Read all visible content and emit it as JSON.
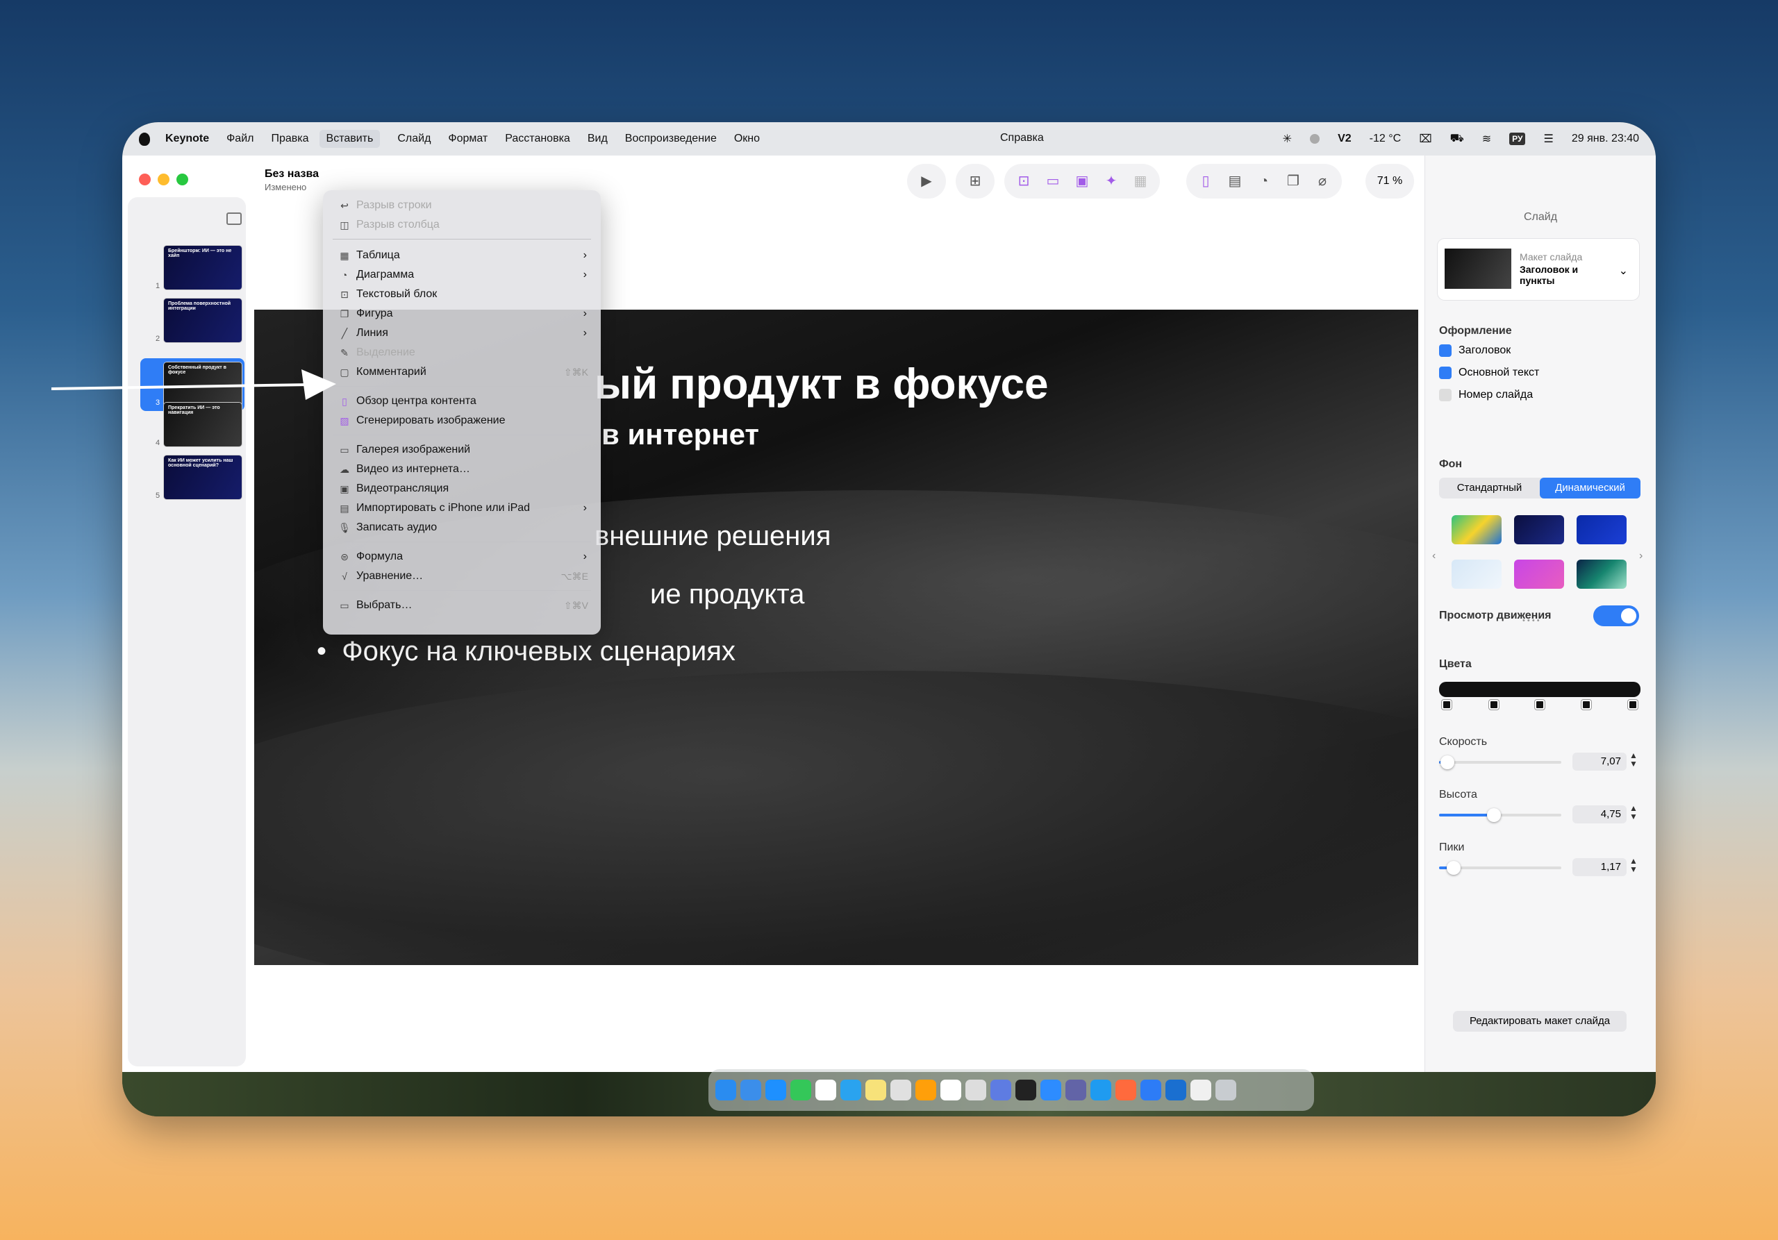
{
  "menubar": {
    "app": "Keynote",
    "items": [
      "Файл",
      "Правка",
      "Вставить",
      "Слайд",
      "Формат",
      "Расстановка",
      "Вид",
      "Воспроизведение",
      "Окно"
    ],
    "center": "Справка",
    "status": {
      "v2": "V2",
      "weather": "-12 °C",
      "kb": "РУ",
      "datetime": "29 янв. 23:40"
    }
  },
  "doc": {
    "title": "Без назва",
    "subtitle": "Изменено"
  },
  "toolbar": {
    "zoom": "71 %"
  },
  "slides": [
    {
      "n": "1",
      "t": "Брейншторм: ИИ — это не хайп"
    },
    {
      "n": "2",
      "t": "Проблема поверхностной интеграции"
    },
    {
      "n": "3",
      "t": "Собственный продукт в фокусе"
    },
    {
      "n": "4",
      "t": "Прекратить ИИ — это навигация"
    },
    {
      "n": "5",
      "t": "Как ИИ может усилить наш основной сценарий?"
    }
  ],
  "slide": {
    "title": "Собственный продукт в фокусе",
    "subtitle": "Хватит смотреть в интернет",
    "bullets": [
      "Не полагаться на внешние решения",
      "Углубленное знание продукта",
      "Фокус на ключевых сценариях"
    ],
    "title_visible": "ый продукт в фокусе",
    "subtitle_visible": "в интернет",
    "b1_visible": "внешние решения",
    "b2_visible": "ие продукта"
  },
  "menu": {
    "r1": "Разрыв строки",
    "r2": "Разрыв столбца",
    "r3": "Таблица",
    "r4": "Диаграмма",
    "r5": "Текстовый блок",
    "r6": "Фигура",
    "r7": "Линия",
    "r8": "Выделение",
    "r9": "Комментарий",
    "r9sc": "⇧⌘K",
    "r10": "Обзор центра контента",
    "r11": "Сгенерировать изображение",
    "r12": "Галерея изображений",
    "r13": "Видео из интернета…",
    "r14": "Видеотрансляция",
    "r15": "Импортировать с iPhone или iPad",
    "r16": "Записать аудио",
    "r17": "Формула",
    "r18": "Уравнение…",
    "r18sc": "⌥⌘E",
    "r19": "Выбрать…",
    "r19sc": "⇧⌘V"
  },
  "inspector": {
    "header": "Слайд",
    "layout_label": "Макет слайда",
    "layout_value": "Заголовок и пункты",
    "design": "Оформление",
    "cb_title": "Заголовок",
    "cb_body": "Основной текст",
    "cb_num": "Номер слайда",
    "bg": "Фон",
    "seg_std": "Стандартный",
    "seg_dyn": "Динамический",
    "motion": "Просмотр движения",
    "colors": "Цвета",
    "speed": "Скорость",
    "speed_val": "7,07",
    "speed_frac": 0.07,
    "height": "Высота",
    "height_val": "4,75",
    "height_frac": 0.45,
    "peaks": "Пики",
    "peaks_val": "1,17",
    "peaks_frac": 0.12,
    "edit": "Редактировать макет слайда"
  },
  "swatch_colors": [
    "#2ec27e",
    "#0b0f3f",
    "#1b3fd6",
    "#d7e8f7",
    "#c846e6",
    "#16856f"
  ],
  "colors": {
    "accent": "#2f7df6"
  }
}
